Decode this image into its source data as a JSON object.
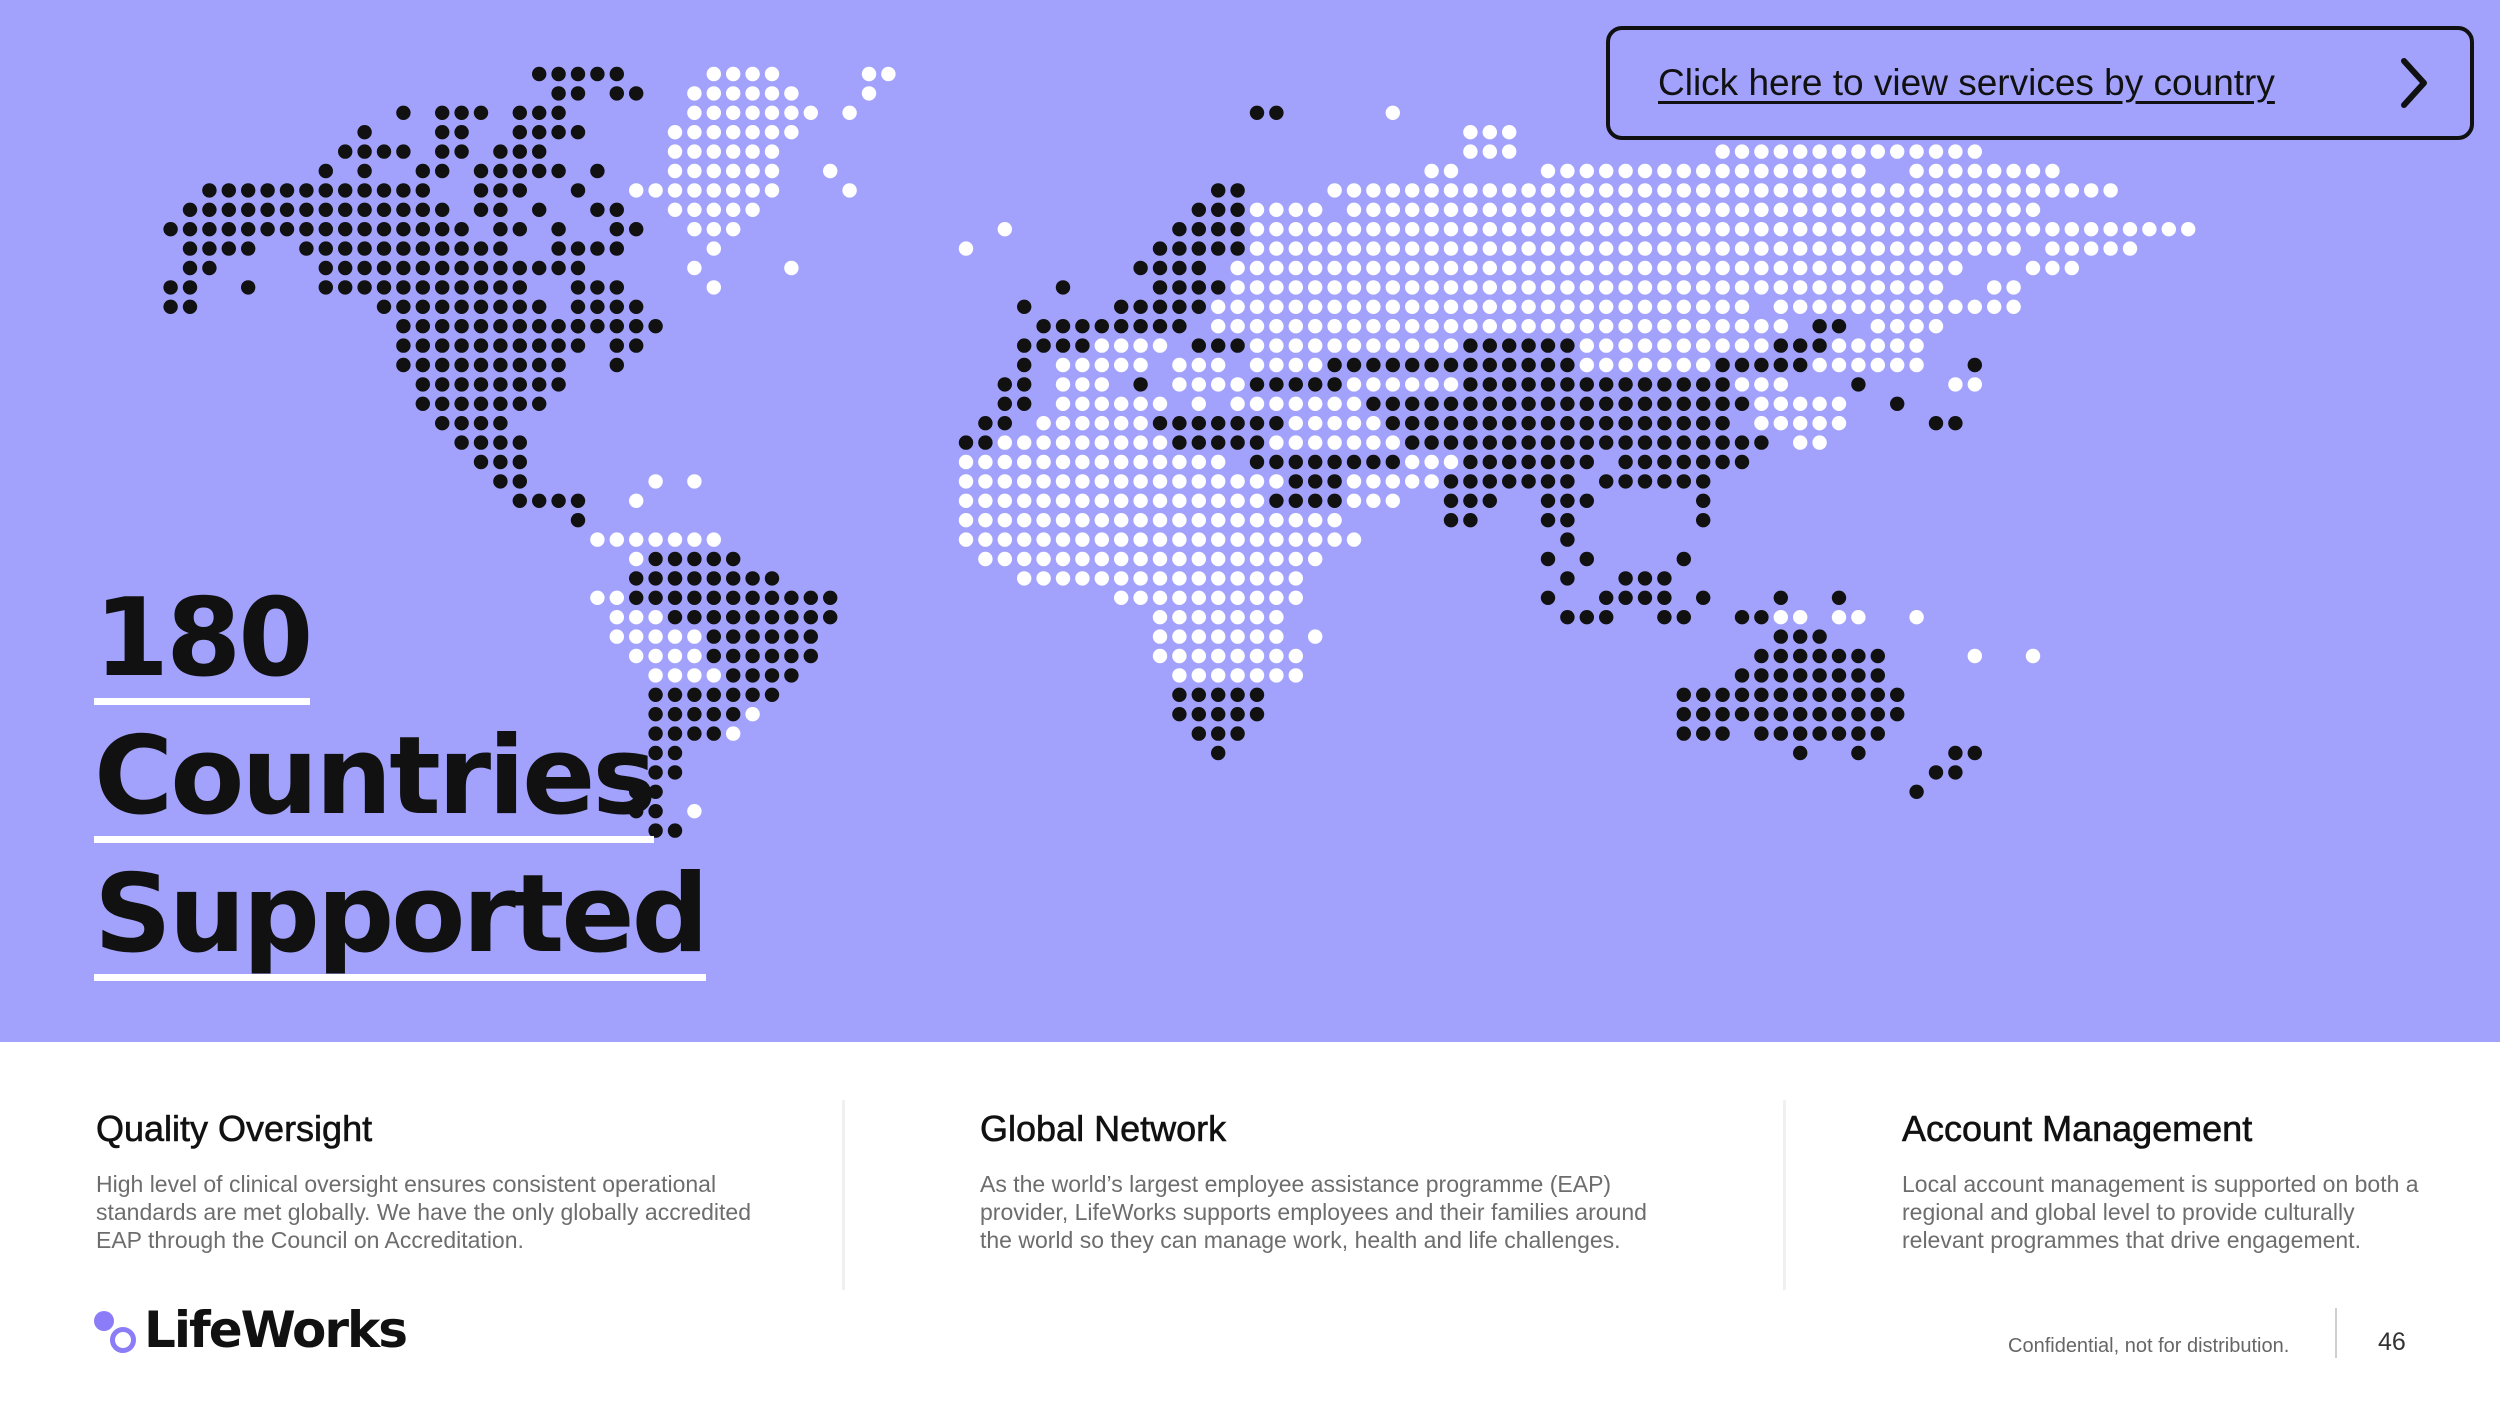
{
  "hero": {
    "headline": [
      "180",
      "Countries",
      "Supported"
    ],
    "map": {
      "label": "world-map",
      "colors": {
        "served": "#111111",
        "other": "#ffffff",
        "background": "#a2a2fd"
      }
    },
    "cta": {
      "label": "Click here to view services by country",
      "icon": "chevron-right-icon"
    }
  },
  "features": [
    {
      "title": "Quality Oversight",
      "body": "High level of clinical oversight ensures consistent operational standards are met globally. We have the only globally accredited EAP through the Council on Accreditation."
    },
    {
      "title": "Global Network",
      "body": "As the world’s largest employee assistance programme (EAP) provider, LifeWorks supports employees and their families around the world so they can manage work, health and life challenges."
    },
    {
      "title": "Account Management",
      "body": "Local account management is supported on both a regional and global level to provide culturally relevant programmes that drive engagement."
    }
  ],
  "footer": {
    "brand": "LifeWorks",
    "note": "Confidential, not for distribution.",
    "page": "46"
  }
}
